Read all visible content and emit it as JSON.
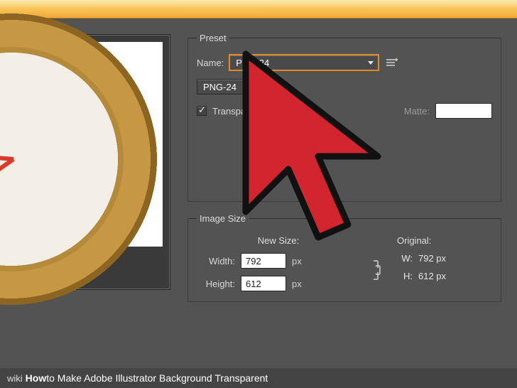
{
  "preset": {
    "legend": "Preset",
    "name_label": "Name:",
    "name_value": "PNG-24",
    "format_value": "PNG-24",
    "transparency_label": "Transparency",
    "transparency_checked": true,
    "matte_label": "Matte:"
  },
  "image_size": {
    "legend": "Image Size",
    "new_size_label": "New Size:",
    "width_label": "Width:",
    "height_label": "Height:",
    "width_value": "792",
    "height_value": "612",
    "unit": "px",
    "original_label": "Original:",
    "orig_w_label": "W:",
    "orig_h_label": "H:",
    "orig_w_value": "792 px",
    "orig_h_value": "612 px"
  },
  "footer": {
    "prefix": "wiki",
    "title_bold": "How",
    "title_rest": " to Make Adobe Illustrator Background Transparent"
  },
  "colors": {
    "cursor_fill": "#d1252f",
    "highlight": "#e08a2c"
  }
}
